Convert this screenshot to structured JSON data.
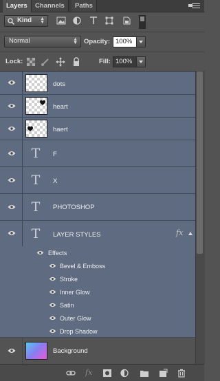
{
  "tabs": [
    {
      "label": "Layers",
      "active": true
    },
    {
      "label": "Channels",
      "active": false
    },
    {
      "label": "Paths",
      "active": false
    }
  ],
  "filter": {
    "kind_label": "Kind"
  },
  "blend": {
    "mode": "Normal",
    "opacity_label": "Opacity:",
    "opacity_value": "100%"
  },
  "lockrow": {
    "lock_label": "Lock:",
    "fill_label": "Fill:",
    "fill_value": "100%"
  },
  "layers": [
    {
      "name": "dots",
      "type": "pixel"
    },
    {
      "name": "heart",
      "type": "pixel"
    },
    {
      "name": "haert",
      "type": "pixel"
    },
    {
      "name": "F",
      "type": "text"
    },
    {
      "name": "X",
      "type": "text"
    },
    {
      "name": "PHOTOSHOP",
      "type": "text"
    },
    {
      "name": "LAYER STYLES",
      "type": "text",
      "fx": "fx"
    },
    {
      "name": "Background",
      "type": "gradient"
    }
  ],
  "effects": {
    "label": "Effects",
    "items": [
      "Bevel & Emboss",
      "Stroke",
      "Inner Glow",
      "Satin",
      "Outer Glow",
      "Drop Shadow"
    ]
  },
  "colors": {
    "selected_row": "#5e6b80",
    "panel_bg": "#535353"
  },
  "icons": [
    "filter-pixel-icon",
    "filter-adjustment-icon",
    "filter-type-icon",
    "filter-shape-icon",
    "filter-smartobject-icon",
    "eye-icon",
    "link-layers-icon",
    "fx-icon",
    "mask-icon",
    "adjustment-layer-icon",
    "group-icon",
    "new-layer-icon",
    "trash-icon"
  ]
}
